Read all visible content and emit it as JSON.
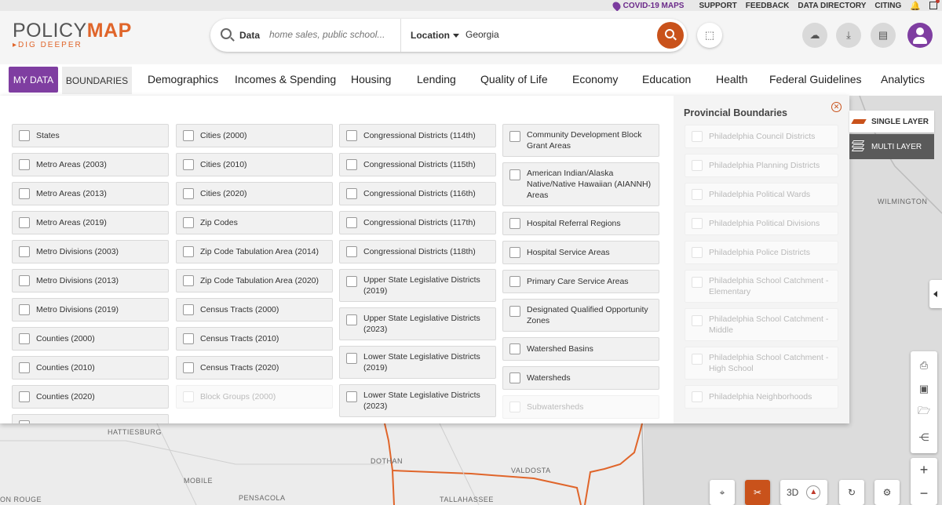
{
  "utility": {
    "covid": "COVID-19 MAPS",
    "support": "SUPPORT",
    "feedback": "FEEDBACK",
    "data_directory": "DATA DIRECTORY",
    "citing": "CITING"
  },
  "logo": {
    "main_a": "POLICY",
    "main_b": "MAP",
    "tagline": "DIG DEEPER"
  },
  "search": {
    "data_label": "Data",
    "data_placeholder": "home sales, public school...",
    "location_label": "Location",
    "location_value": "Georgia"
  },
  "nav": {
    "my_data": "MY DATA",
    "boundaries": "BOUNDARIES",
    "items": [
      "Demographics",
      "Incomes & Spending",
      "Housing",
      "Lending",
      "Quality of Life",
      "Economy",
      "Education",
      "Health",
      "Federal Guidelines",
      "Analytics"
    ]
  },
  "boundaries": {
    "col1": [
      {
        "label": "States"
      },
      {
        "label": "Metro Areas (2003)"
      },
      {
        "label": "Metro Areas (2013)"
      },
      {
        "label": "Metro Areas (2019)"
      },
      {
        "label": "Metro Divisions (2003)"
      },
      {
        "label": "Metro Divisions (2013)"
      },
      {
        "label": "Metro Divisions (2019)"
      },
      {
        "label": "Counties (2000)"
      },
      {
        "label": "Counties (2010)"
      },
      {
        "label": "Counties (2020)"
      }
    ],
    "col2": [
      {
        "label": "Cities (2000)"
      },
      {
        "label": "Cities (2010)"
      },
      {
        "label": "Cities (2020)"
      },
      {
        "label": "Zip Codes"
      },
      {
        "label": "Zip Code Tabulation Area (2014)"
      },
      {
        "label": "Zip Code Tabulation Area (2020)"
      },
      {
        "label": "Census Tracts (2000)"
      },
      {
        "label": "Census Tracts (2010)"
      },
      {
        "label": "Census Tracts (2020)"
      },
      {
        "label": "Block Groups (2000)"
      }
    ],
    "col3": [
      {
        "label": "Congressional Districts (114th)"
      },
      {
        "label": "Congressional Districts (115th)"
      },
      {
        "label": "Congressional Districts (116th)"
      },
      {
        "label": "Congressional Districts (117th)"
      },
      {
        "label": "Congressional Districts (118th)"
      },
      {
        "label": "Upper State Legislative Districts (2019)"
      },
      {
        "label": "Upper State Legislative Districts (2023)"
      },
      {
        "label": "Lower State Legislative Districts (2019)"
      },
      {
        "label": "Lower State Legislative Districts (2023)"
      }
    ],
    "col4": [
      {
        "label": "Community Development Block Grant Areas"
      },
      {
        "label": "American Indian/Alaska Native/Native Hawaiian (AIANNH) Areas"
      },
      {
        "label": "Hospital Referral Regions"
      },
      {
        "label": "Hospital Service Areas"
      },
      {
        "label": "Primary Care Service Areas"
      },
      {
        "label": "Designated Qualified Opportunity Zones"
      },
      {
        "label": "Watershed Basins"
      },
      {
        "label": "Watersheds"
      },
      {
        "label": "Subwatersheds"
      }
    ]
  },
  "provincial": {
    "title": "Provincial Boundaries",
    "items": [
      "Philadelphia Council Districts",
      "Philadelphia Planning Districts",
      "Philadelphia Political Wards",
      "Philadelphia Political Divisions",
      "Philadelphia Police Districts",
      "Philadelphia School Catchment - Elementary",
      "Philadelphia School Catchment - Middle",
      "Philadelphia School Catchment - High School",
      "Philadelphia Neighborhoods"
    ]
  },
  "layers": {
    "single": "SINGLE LAYER",
    "multi": "MULTI LAYER"
  },
  "map_labels": {
    "hattiesburg": "HATTIESBURG",
    "dothan": "DOTHAN",
    "valdosta": "VALDOSTA",
    "mobile": "MOBILE",
    "pensacola": "PENSACOLA",
    "tallahassee": "TALLAHASSEE",
    "rouge": "ON ROUGE",
    "wilmington": "WILMINGTON"
  },
  "bottom": {
    "three_d": "3D"
  },
  "colors": {
    "accent": "#e0652a",
    "primary_purple": "#7f3ea1",
    "search_button": "#c9521b",
    "state_border": "#e0652a"
  }
}
